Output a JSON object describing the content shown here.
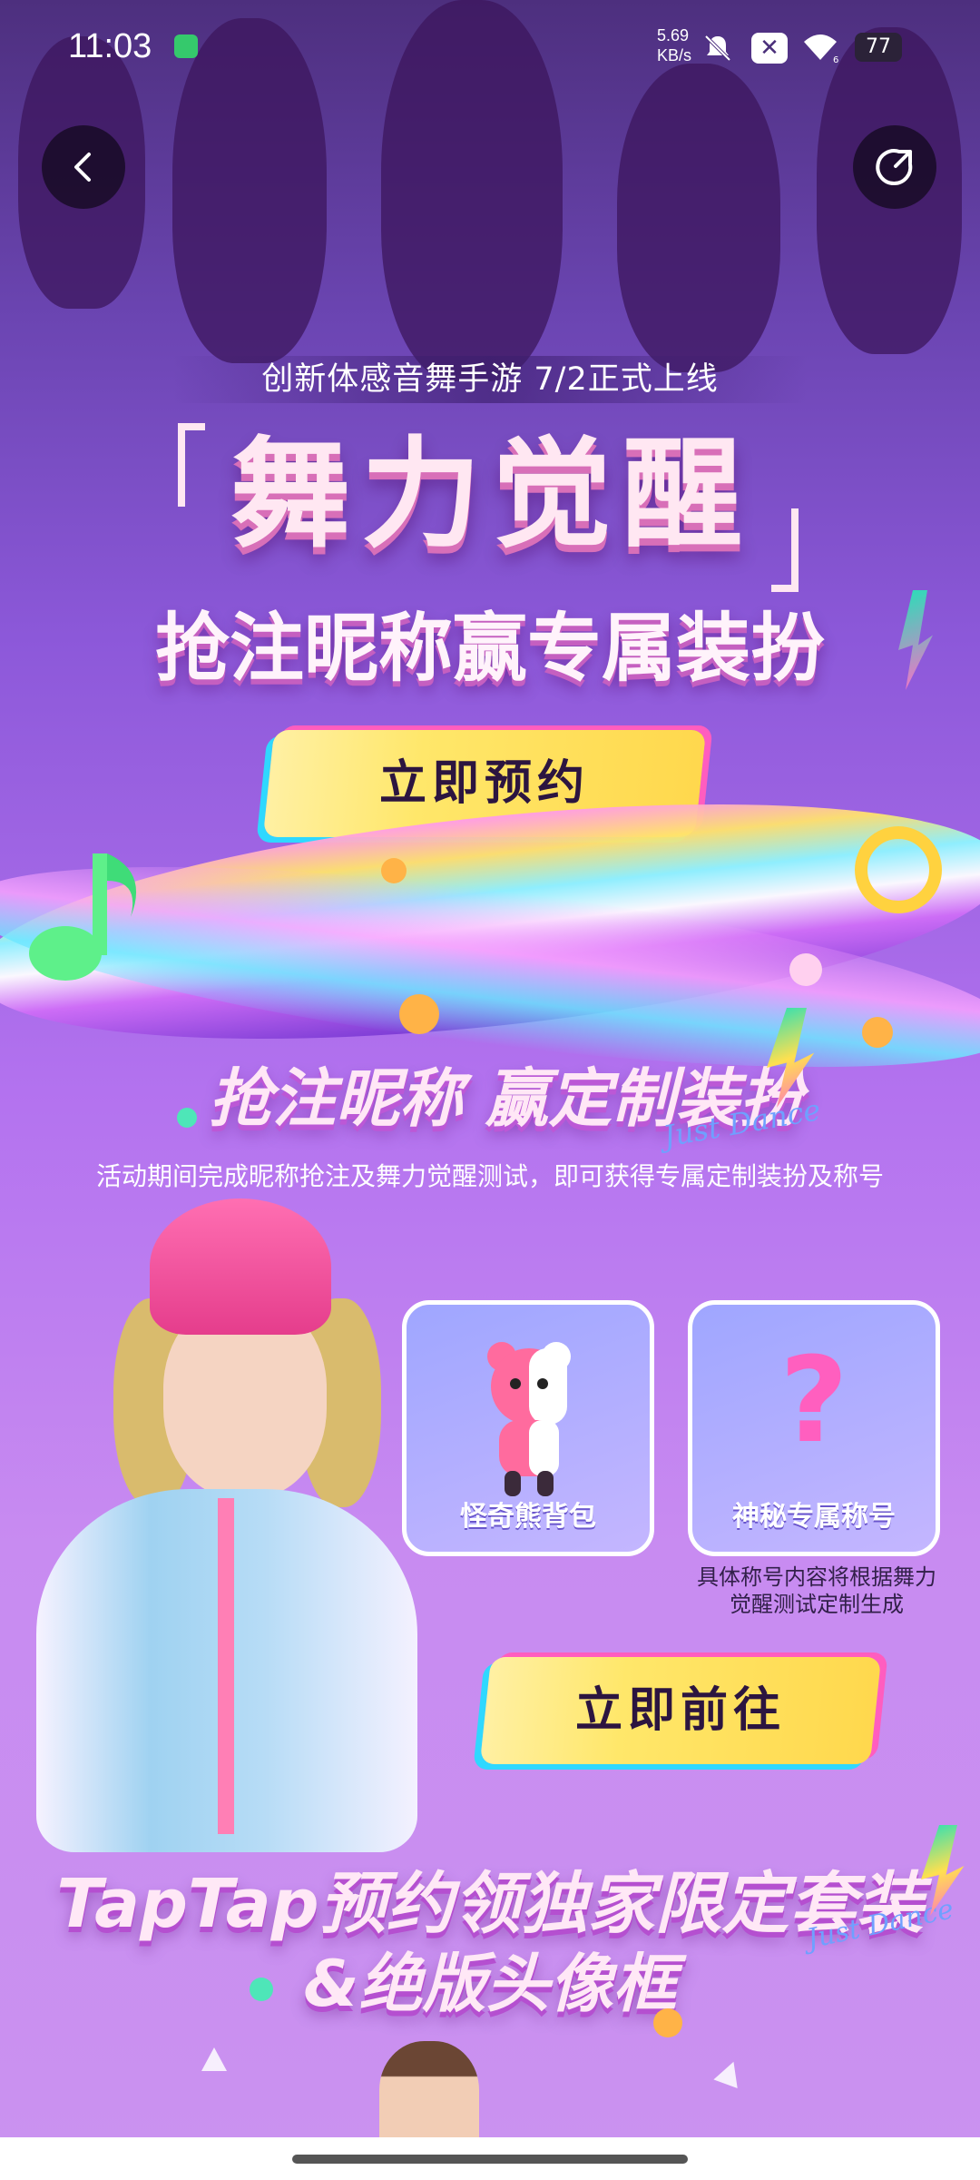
{
  "status_bar": {
    "time": "11:03",
    "network_speed_value": "5.69",
    "network_speed_unit": "KB/s",
    "wifi_level": "6",
    "battery": "77"
  },
  "nav": {
    "back_icon": "chevron-left-icon",
    "share_icon": "share-icon"
  },
  "hero": {
    "tagline": "创新体感音舞手游 7/2正式上线",
    "game_title": "舞力觉醒",
    "slogan": "抢注昵称赢专属装扮",
    "reserve_button": "立即预约"
  },
  "event": {
    "title": "抢注昵称 赢定制装扮",
    "title_tag": "Just Dance",
    "description": "活动期间完成昵称抢注及舞力觉醒测试，即可获得专属定制装扮及称号",
    "rewards": [
      {
        "label": "怪奇熊背包",
        "icon": "bear-backpack-icon"
      },
      {
        "label": "神秘专属称号",
        "icon": "question-mark-icon"
      }
    ],
    "title_note": "具体称号内容将根据舞力觉醒测试定制生成",
    "go_button": "立即前往"
  },
  "taptap": {
    "title": "TapTap预约领独家限定套装",
    "subtitle": "&绝版头像框",
    "tag": "Just Dance"
  },
  "colors": {
    "accent_yellow": "#ffe76a",
    "accent_pink": "#ff5dbf",
    "accent_cyan": "#2fd8ff",
    "bg_purple": "#8c58d9"
  }
}
